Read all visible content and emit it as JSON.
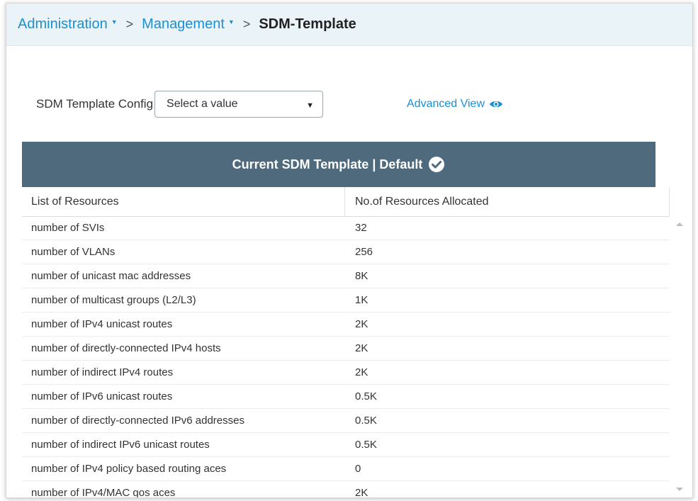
{
  "breadcrumb": {
    "items": [
      {
        "label": "Administration"
      },
      {
        "label": "Management"
      }
    ],
    "current": "SDM-Template",
    "separator": ">"
  },
  "config": {
    "label": "SDM Template Config",
    "select_value": "Select a value"
  },
  "advanced_view": {
    "label": "Advanced View",
    "icon": "eye-icon"
  },
  "panel": {
    "title": "Current SDM Template | Default",
    "icon": "check-circle-icon"
  },
  "table": {
    "columns": [
      "List of Resources",
      "No.of Resources Allocated"
    ],
    "rows": [
      {
        "resource": "number of SVIs",
        "allocated": "32"
      },
      {
        "resource": "number of VLANs",
        "allocated": "256"
      },
      {
        "resource": "number of unicast mac addresses",
        "allocated": "8K"
      },
      {
        "resource": "number of multicast groups (L2/L3)",
        "allocated": "1K"
      },
      {
        "resource": "number of IPv4 unicast routes",
        "allocated": "2K"
      },
      {
        "resource": "number of directly-connected IPv4 hosts",
        "allocated": "2K"
      },
      {
        "resource": "number of indirect IPv4 routes",
        "allocated": "2K"
      },
      {
        "resource": "number of IPv6 unicast routes",
        "allocated": "0.5K"
      },
      {
        "resource": "number of directly-connected IPv6 addresses",
        "allocated": "0.5K"
      },
      {
        "resource": "number of indirect IPv6 unicast routes",
        "allocated": "0.5K"
      },
      {
        "resource": "number of IPv4 policy based routing aces",
        "allocated": "0"
      },
      {
        "resource": "number of IPv4/MAC qos aces",
        "allocated": "2K"
      }
    ]
  },
  "colors": {
    "link": "#1b8fd2",
    "header_bg": "#4f6a7d",
    "breadcrumb_bg": "#eaf3f8"
  }
}
